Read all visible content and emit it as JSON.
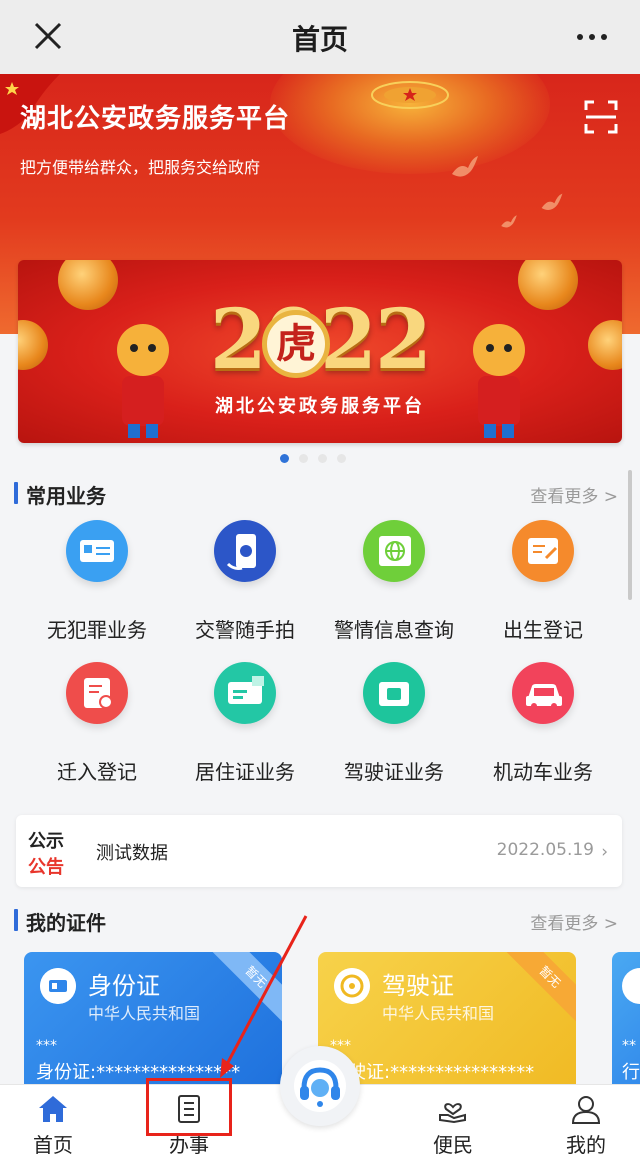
{
  "topbar": {
    "title": "首页",
    "close_icon": "close-icon",
    "more_icon": "more-icon"
  },
  "hero": {
    "title": "湖北公安政务服务平台",
    "subtitle": "把方便带给群众，把服务交给政府",
    "scan_icon": "scan-icon"
  },
  "carousel": {
    "year_text": "2022",
    "tiger_char": "虎",
    "banner_text": "湖北公安政务服务平台",
    "slide_count": 4,
    "active_index": 0
  },
  "common_services": {
    "title": "常用业务",
    "more": "查看更多 >",
    "items": [
      {
        "label": "无犯罪业务",
        "icon": "certificate-icon",
        "color": "#3aa0f2"
      },
      {
        "label": "交警随手拍",
        "icon": "phone-camera-icon",
        "color": "#2c56c8"
      },
      {
        "label": "警情信息查询",
        "icon": "globe-icon",
        "color": "#6fcf3a"
      },
      {
        "label": "出生登记",
        "icon": "document-edit-icon",
        "color": "#f58a2c"
      },
      {
        "label": "迁入登记",
        "icon": "id-card-icon",
        "color": "#ef4d4b"
      },
      {
        "label": "居住证业务",
        "icon": "residence-card-icon",
        "color": "#23c7a5"
      },
      {
        "label": "驾驶证业务",
        "icon": "license-icon",
        "color": "#1ec59c"
      },
      {
        "label": "机动车业务",
        "icon": "car-icon",
        "color": "#f2435b"
      }
    ]
  },
  "notice": {
    "tag_line1": "公示",
    "tag_line2": "公告",
    "text": "测试数据",
    "date": "2022.05.19"
  },
  "my_certificates": {
    "title": "我的证件",
    "more": "查看更多 >",
    "cards": [
      {
        "name": "身份证",
        "sub": "中华人民共和国",
        "stars": "***",
        "number": "身份证:****************",
        "ribbon": "暂无",
        "color": "#2f86ea"
      },
      {
        "name": "驾驶证",
        "sub": "中华人民共和国",
        "stars": "***",
        "number": "驾驶证:****************",
        "ribbon": "暂无",
        "color": "#f4c634"
      },
      {
        "name": "",
        "sub": "",
        "stars": "**",
        "number": "行",
        "ribbon": "",
        "color": "#3fa1ee"
      }
    ]
  },
  "tabbar": {
    "items": [
      {
        "label": "首页",
        "icon": "home-icon"
      },
      {
        "label": "办事",
        "icon": "document-icon"
      },
      {
        "label": "便民",
        "icon": "heart-hand-icon"
      },
      {
        "label": "我的",
        "icon": "user-icon"
      }
    ],
    "center_icon": "customer-service-icon"
  }
}
